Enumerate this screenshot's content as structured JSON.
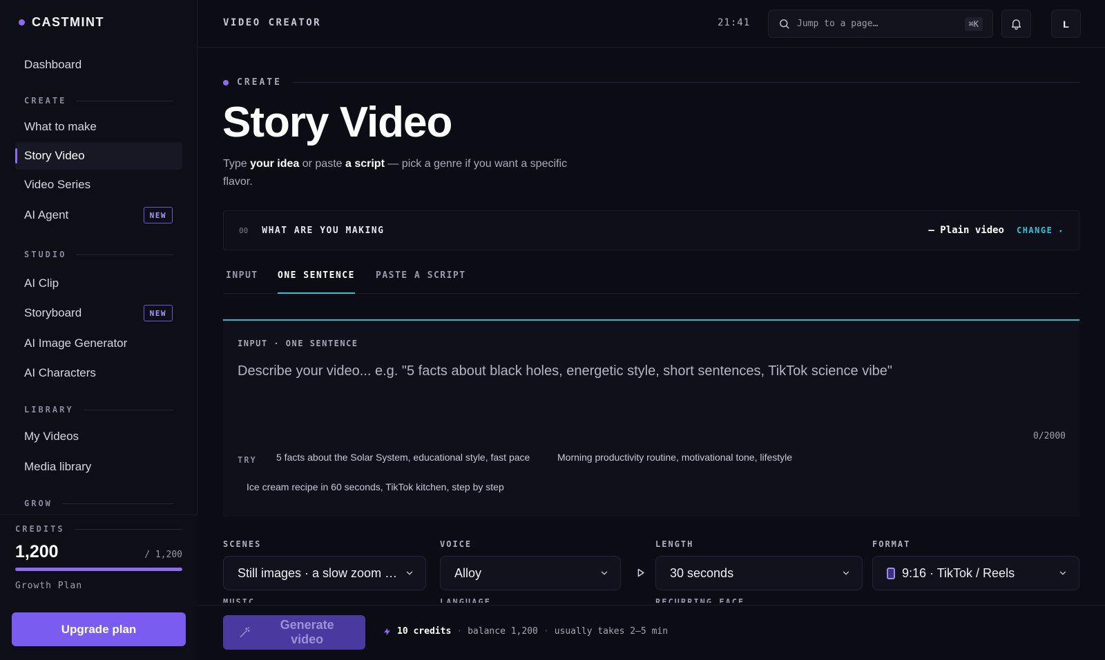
{
  "brand": {
    "name": "CASTMINT",
    "accent": "#8b6cf6"
  },
  "sidebar": {
    "top_item": "Dashboard",
    "sections": {
      "create": "CREATE",
      "studio": "STUDIO",
      "library": "LIBRARY",
      "grow": "GROW"
    },
    "items": {
      "what_to_make": "What to make",
      "story_video": "Story Video",
      "video_series": "Video Series",
      "ai_agent": "AI Agent",
      "ai_clip": "AI Clip",
      "storyboard": "Storyboard",
      "ai_image_generator": "AI Image Generator",
      "ai_characters": "AI Characters",
      "my_videos": "My Videos",
      "media_library": "Media library"
    },
    "new_badge": "NEW",
    "credits": {
      "label": "CREDITS",
      "value": "1,200",
      "total": "/ 1,200",
      "fraction": 1.0,
      "plan": "Growth Plan"
    },
    "upgrade_label": "Upgrade plan"
  },
  "topbar": {
    "title": "VIDEO CREATOR",
    "time": "21:41",
    "search_placeholder": "Jump to a page…",
    "search_shortcut": "⌘K",
    "avatar_initial": "L"
  },
  "main": {
    "eyebrow": "CREATE",
    "title": "Story Video",
    "subtitle": {
      "p1": "Type ",
      "b1": "your idea",
      "p2": " or paste ",
      "b2": "a script",
      "p3": " — pick a genre if you want a specific flavor."
    },
    "making": {
      "number": "00",
      "label": "WHAT ARE YOU MAKING",
      "value": "— Plain video",
      "change": "CHANGE"
    },
    "tabs": {
      "input": "INPUT",
      "one_sentence": "ONE SENTENCE",
      "paste_script": "PASTE A SCRIPT"
    },
    "input_panel": {
      "label": "INPUT · ONE SENTENCE",
      "placeholder": "Describe your video... e.g. \"5 facts about black holes, energetic style, short sentences, TikTok science vibe\"",
      "count": "0/2000",
      "try_label": "TRY",
      "suggestions": [
        "5 facts about the Solar System, educational style, fast pace",
        "Morning productivity routine, motivational tone, lifestyle",
        "Ice cream recipe in 60 seconds, TikTok kitchen, step by step"
      ]
    },
    "fields": {
      "scenes": {
        "label": "SCENES",
        "value": "Still images · a slow zoom on..."
      },
      "voice": {
        "label": "VOICE",
        "value": "Alloy"
      },
      "length": {
        "label": "LENGTH",
        "value": "30 seconds"
      },
      "format": {
        "label": "FORMAT",
        "value": "9:16 · TikTok / Reels"
      }
    },
    "cutoff_labels": {
      "music": "MUSIC",
      "language": "LANGUAGE",
      "recurring_face": "RECURRING FACE"
    }
  },
  "footer": {
    "generate_label": "Generate video",
    "credits": "10 credits",
    "balance": "balance 1,200",
    "duration": "usually takes 2–5 min",
    "separator": "·"
  },
  "colors": {
    "accent": "#8b6cf6",
    "cyan": "#33c3d6",
    "background": "#0c0c14"
  }
}
